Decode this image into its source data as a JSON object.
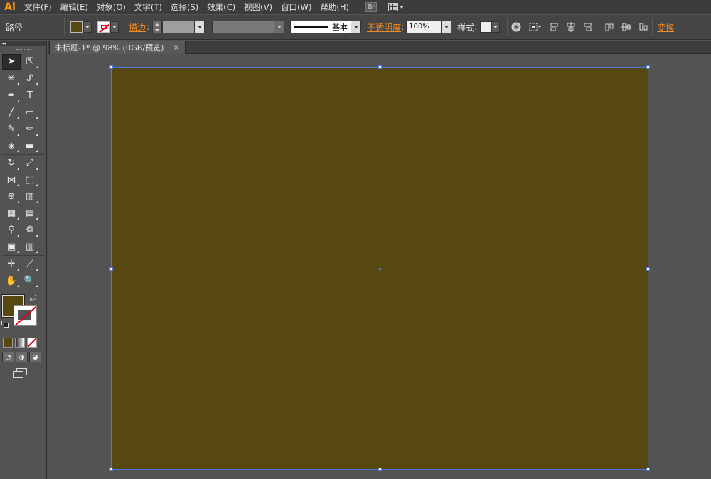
{
  "app": {
    "logo": "Ai"
  },
  "menu": {
    "items": [
      "文件(F)",
      "编辑(E)",
      "对象(O)",
      "文字(T)",
      "选择(S)",
      "效果(C)",
      "视图(V)",
      "窗口(W)",
      "帮助(H)"
    ],
    "bridge_label": "Br"
  },
  "control_bar": {
    "selection_label": "路径",
    "fill_color": "#574710",
    "stroke_label": "描边",
    "brush_label": "基本",
    "opacity_label": "不透明度",
    "opacity_value": "100%",
    "style_label": "样式",
    "transform_label": "变换"
  },
  "document": {
    "tab_title": "未标题-1* @ 98% (RGB/预览)",
    "close_symbol": "×"
  },
  "tools": [
    [
      "selection-tool",
      "direct-selection-tool"
    ],
    [
      "magic-wand-tool",
      "lasso-tool"
    ],
    [
      "pen-tool",
      "type-tool"
    ],
    [
      "line-segment-tool",
      "rectangle-tool"
    ],
    [
      "paintbrush-tool",
      "pencil-tool"
    ],
    [
      "blob-brush-tool",
      "eraser-tool"
    ],
    [
      "rotate-tool",
      "scale-tool"
    ],
    [
      "width-tool",
      "free-transform-tool"
    ],
    [
      "shape-builder-tool",
      "perspective-grid-tool"
    ],
    [
      "mesh-tool",
      "gradient-tool"
    ],
    [
      "eyedropper-tool",
      "blend-tool"
    ],
    [
      "symbol-sprayer-tool",
      "column-graph-tool"
    ],
    [
      "artboard-tool",
      "slice-tool"
    ],
    [
      "hand-tool",
      "zoom-tool"
    ]
  ],
  "tool_glyphs": [
    "➤",
    "⇱",
    "✳",
    "ᔑ",
    "✒",
    "T",
    "╱",
    "▭",
    "✎",
    "✏",
    "◈",
    "▬",
    "↻",
    "⤢",
    "⋈",
    "⬚",
    "⊕",
    "▥",
    "▦",
    "▤",
    "⚲",
    "❁",
    "▣",
    "▥",
    "✛",
    "⟋",
    "✋",
    "🔍"
  ],
  "colors": {
    "fill": "#574710",
    "artboard": "#574710",
    "canvas": "#535353",
    "selection": "#4b78d8",
    "accent_link": "#f08a25"
  },
  "toolbar_misc": {
    "collapse_label": "◂◂"
  }
}
